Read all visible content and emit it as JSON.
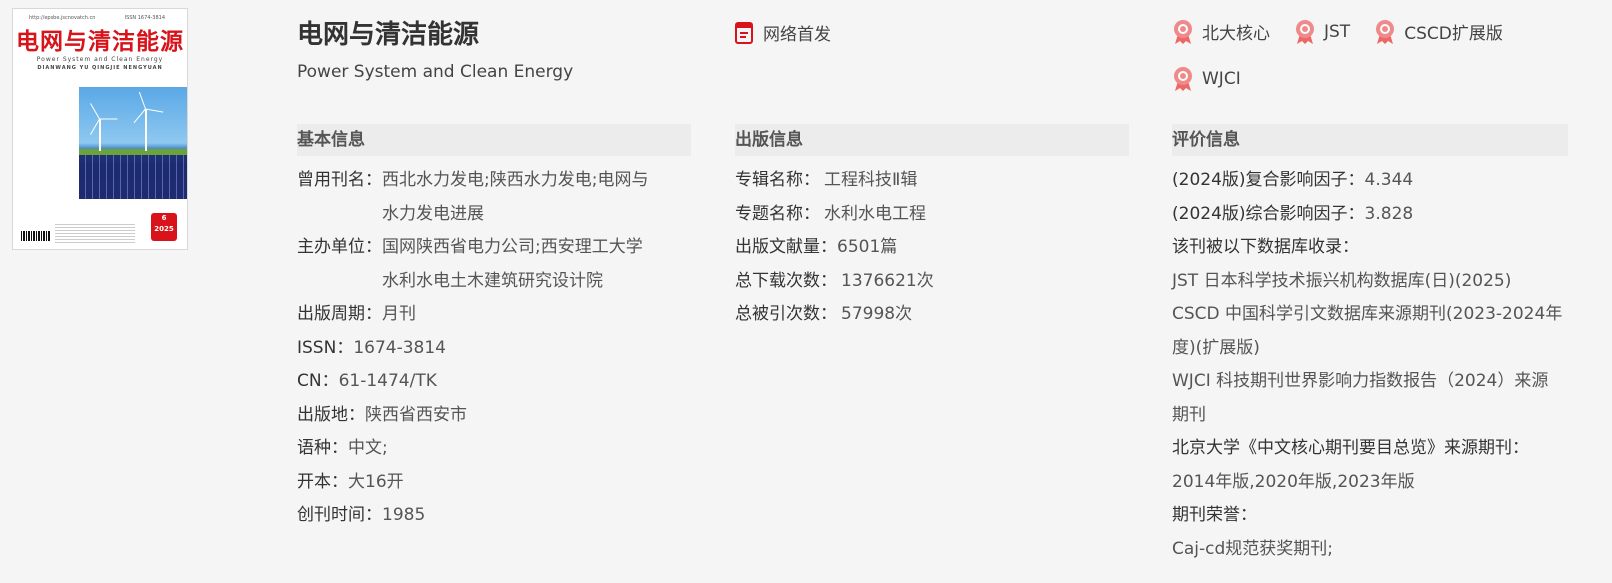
{
  "cover": {
    "url": "http://epsbe.jscnovatch.cn",
    "issn_top": "ISSN 1674-3814",
    "title": "电网与清洁能源",
    "subtitle": "Power System and Clean Energy",
    "pinyin": "DIANWANG YU QINGJIE NENGYUAN",
    "issue_number": "6",
    "issue_year": "2025"
  },
  "journal": {
    "title": "电网与清洁能源",
    "subtitle_en": "Power System and Clean Energy"
  },
  "first_publish": {
    "label": "网络首发",
    "icon": "document-icon"
  },
  "badges": [
    {
      "label": "北大核心",
      "icon": "medal-icon"
    },
    {
      "label": "JST",
      "icon": "medal-icon"
    },
    {
      "label": "CSCD扩展版",
      "icon": "medal-icon"
    },
    {
      "label": "WJCI",
      "icon": "medal-icon"
    }
  ],
  "basic": {
    "heading": "基本信息",
    "former_name_label": "曾用刊名：",
    "former_name_value": [
      "西北水力发电;陕西水力发电;电网与",
      "水力发电进展"
    ],
    "sponsor_label": "主办单位：",
    "sponsor_value": [
      "国网陕西省电力公司;西安理工大学",
      "水利水电土木建筑研究设计院"
    ],
    "period_label": "出版周期：",
    "period_value": "月刊",
    "issn_label": "ISSN：",
    "issn_value": "1674-3814",
    "cn_label": "CN：",
    "cn_value": "61-1474/TK",
    "place_label": "出版地：",
    "place_value": "陕西省西安市",
    "language_label": "语种：",
    "language_value": "中文;",
    "format_label": "开本：",
    "format_value": "大16开",
    "founded_label": "创刊时间：",
    "founded_value": "1985"
  },
  "publication": {
    "heading": "出版信息",
    "series_label": "专辑名称：",
    "series_value": "工程科技Ⅱ辑",
    "topic_label": "专题名称：",
    "topic_value": "水利水电工程",
    "count_label": "出版文献量：",
    "count_value": "6501篇",
    "downloads_label": "总下载次数：",
    "downloads_value": "1376621次",
    "citations_label": "总被引次数：",
    "citations_value": "57998次"
  },
  "evaluation": {
    "heading": "评价信息",
    "composite_label": "(2024版)复合影响因子：",
    "composite_value": "4.344",
    "comprehensive_label": "(2024版)综合影响因子：",
    "comprehensive_value": "3.828",
    "indexed_label": "该刊被以下数据库收录：",
    "indexed": [
      "JST 日本科学技术振兴机构数据库(日)(2025)",
      "CSCD 中国科学引文数据库来源期刊(2023-2024年",
      "度)(扩展版)",
      "WJCI 科技期刊世界影响力指数报告（2024）来源",
      "期刊"
    ],
    "pku_label": "北京大学《中文核心期刊要目总览》来源期刊：",
    "pku_value": "2014年版,2020年版,2023年版",
    "honor_label": "期刊荣誉：",
    "honor_value": "Caj-cd规范获奖期刊;"
  }
}
